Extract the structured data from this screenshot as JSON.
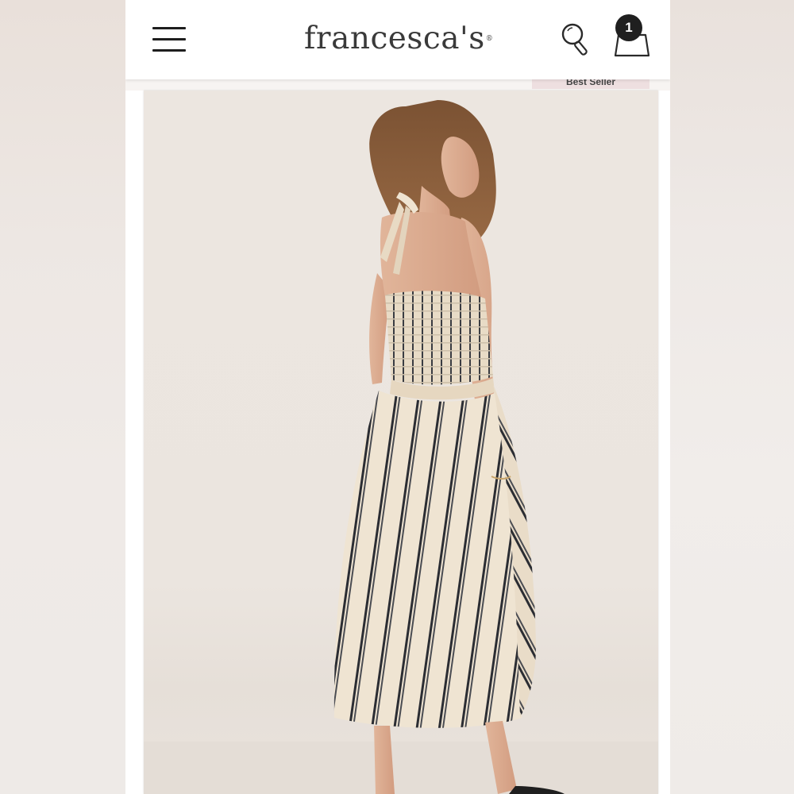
{
  "header": {
    "logo_text": "francesca's",
    "logo_mark": "®",
    "menu_icon": "hamburger-menu-icon",
    "search_icon": "search-icon",
    "cart_icon": "shopping-bag-icon",
    "cart_count": "1"
  },
  "product": {
    "badge": "Best Seller",
    "image_description_icon": "product-photo"
  },
  "colors": {
    "header_bg": "#ffffff",
    "badge_bg": "#eedfe0",
    "cart_badge_bg": "#1f1f1f",
    "photo_bg": "#ece6e0",
    "stripe_dark": "#2b2d33",
    "fabric_cream": "#efe4d2"
  }
}
